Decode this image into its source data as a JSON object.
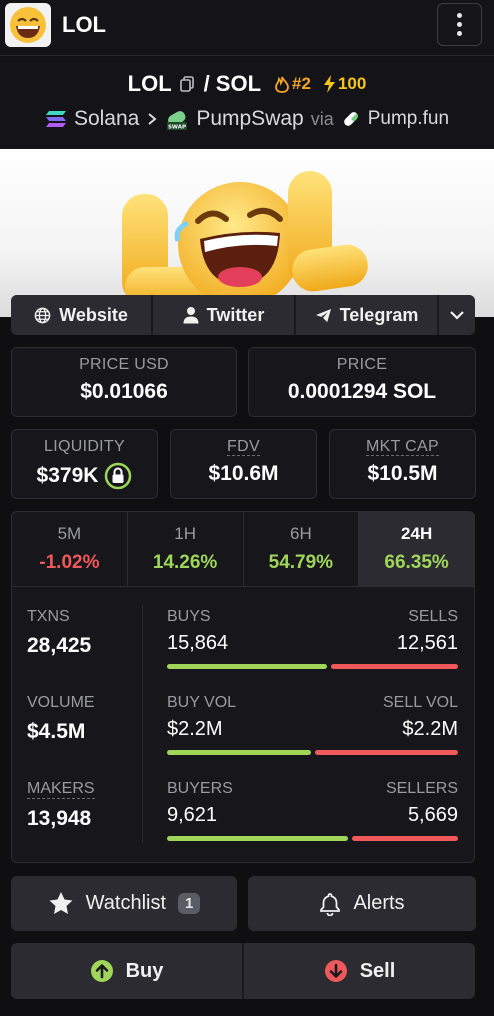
{
  "app": {
    "title": "LOL"
  },
  "pair": {
    "base": "LOL",
    "separator": "/",
    "quote": "SOL",
    "rank": "#2",
    "boost": "100",
    "chain": "Solana",
    "dex": "PumpSwap",
    "via": "via",
    "launchpad": "Pump.fun"
  },
  "socials": {
    "website": "Website",
    "twitter": "Twitter",
    "telegram": "Telegram"
  },
  "prices": {
    "price_usd_label": "PRICE USD",
    "price_usd": "$0.01066",
    "price_label": "PRICE",
    "price_native": "0.0001294 SOL"
  },
  "metrics": {
    "liquidity_label": "LIQUIDITY",
    "liquidity": "$379K",
    "fdv_label": "FDV",
    "fdv": "$10.6M",
    "mktcap_label": "MKT CAP",
    "mktcap": "$10.5M"
  },
  "tabs": [
    {
      "label": "5M",
      "value": "-1.02%",
      "trend": "negative"
    },
    {
      "label": "1H",
      "value": "14.26%",
      "trend": "positive"
    },
    {
      "label": "6H",
      "value": "54.79%",
      "trend": "positive"
    },
    {
      "label": "24H",
      "value": "66.35%",
      "trend": "positive",
      "selected": true
    }
  ],
  "stats": {
    "txns_label": "TXNS",
    "txns": "28,425",
    "buys_label": "BUYS",
    "buys": "15,864",
    "sells_label": "SELLS",
    "sells": "12,561",
    "buys_fraction": 0.558,
    "volume_label": "VOLUME",
    "volume": "$4.5M",
    "buy_vol_label": "BUY VOL",
    "buy_vol": "$2.2M",
    "sell_vol_label": "SELL VOL",
    "sell_vol": "$2.2M",
    "buy_vol_fraction": 0.5,
    "makers_label": "MAKERS",
    "makers": "13,948",
    "buyers_label": "BUYERS",
    "buyers": "9,621",
    "sellers_label": "SELLERS",
    "sellers": "5,669",
    "buyers_fraction": 0.629
  },
  "actions": {
    "watchlist": "Watchlist",
    "watchlist_count": "1",
    "alerts": "Alerts",
    "buy": "Buy",
    "sell": "Sell"
  },
  "colors": {
    "positive": "#9fd65a",
    "negative": "#f0595b",
    "rank": "#f5a623",
    "boost": "#f5c518"
  }
}
